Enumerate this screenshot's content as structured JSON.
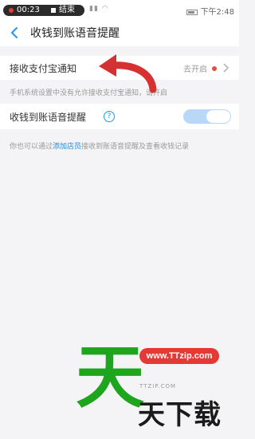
{
  "status_bar": {
    "record_time": "00:23",
    "record_stop_label": "结束",
    "clock": "下午2:48"
  },
  "nav": {
    "title": "收钱到账语音提醒"
  },
  "alipay_notice": {
    "label": "接收支付宝通知",
    "status": "去开启",
    "hint": "手机系统设置中没有允许接收支付宝通知，请开启"
  },
  "voice_reminder": {
    "label": "收钱到账语音提醒",
    "toggle_on": true,
    "help_symbol": "?"
  },
  "footer_hint": {
    "prefix": "你也可以通过",
    "link": "添加店员",
    "suffix": "接收到账语音提醒及查看收钱记录"
  },
  "watermark": {
    "url": "www.TTzip.com",
    "big_char": "天",
    "main_text": "天下载",
    "sub_text": "TTZIP.COM"
  },
  "colors": {
    "accent": "#2196f3",
    "alert_red": "#e84c3d",
    "toggle_track": "#b9d7f7",
    "watermark_green": "#1ea51e"
  }
}
